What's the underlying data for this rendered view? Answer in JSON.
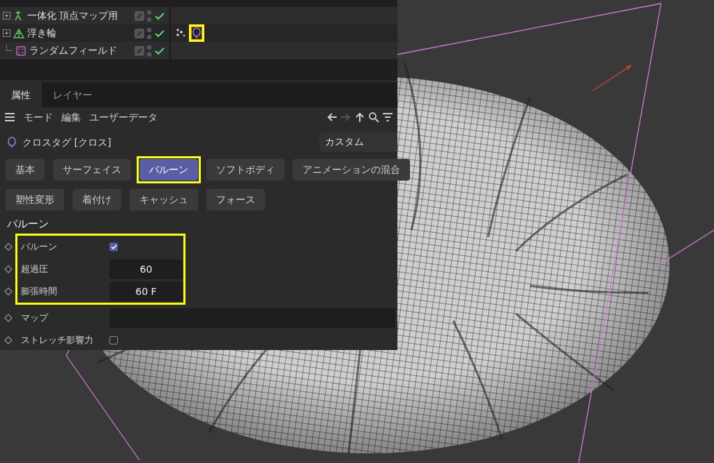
{
  "object_manager": {
    "rows": [
      {
        "name": "一体化 頂点マップ用",
        "kind": "connect",
        "expandable": true,
        "tags": []
      },
      {
        "name": "浮き輪",
        "kind": "polygon",
        "expandable": true,
        "tags": [
          {
            "kind": "vertex-map",
            "highlighted": false
          },
          {
            "kind": "cloth",
            "highlighted": true
          }
        ]
      },
      {
        "name": "ランダムフィールド",
        "kind": "field",
        "expandable": false,
        "tags": []
      }
    ]
  },
  "tabs": [
    {
      "label": "属性",
      "selected": true
    },
    {
      "label": "レイヤー",
      "selected": false
    }
  ],
  "menu": [
    "モード",
    "編集",
    "ユーザーデータ"
  ],
  "nav_buttons": [
    {
      "kind": "back",
      "disabled": false
    },
    {
      "kind": "forward",
      "disabled": true
    },
    {
      "kind": "up",
      "disabled": false
    },
    {
      "kind": "search",
      "disabled": false
    },
    {
      "kind": "filter",
      "disabled": false
    }
  ],
  "object_title": "クロスタグ [クロス]",
  "preset": "カスタム",
  "page_tabs": [
    [
      {
        "label": "基本",
        "selected": false,
        "highlighted": false
      },
      {
        "label": "サーフェイス",
        "selected": false,
        "highlighted": false
      },
      {
        "label": "バルーン",
        "selected": true,
        "highlighted": true
      },
      {
        "label": "ソフトボディ",
        "selected": false,
        "highlighted": false
      },
      {
        "label": "アニメーションの混合",
        "selected": false,
        "highlighted": false
      }
    ],
    [
      {
        "label": "塑性変形",
        "selected": false,
        "highlighted": false
      },
      {
        "label": "着付け",
        "selected": false,
        "highlighted": false
      },
      {
        "label": "キャッシュ",
        "selected": false,
        "highlighted": false
      },
      {
        "label": "フォース",
        "selected": false,
        "highlighted": false
      }
    ]
  ],
  "section_title": "バルーン",
  "attribute_groups": [
    {
      "highlighted": true,
      "rows": [
        {
          "kind": "checkbox",
          "label": "バルーン",
          "checked": true
        },
        {
          "kind": "number",
          "label": "超過圧",
          "value": "60"
        },
        {
          "kind": "number",
          "label": "膨張時間",
          "value": "60 F"
        }
      ]
    },
    {
      "highlighted": false,
      "rows": [
        {
          "kind": "link",
          "label": "マップ"
        },
        {
          "kind": "checkbox",
          "label": "ストレッチ影響力",
          "checked": false
        }
      ]
    }
  ]
}
